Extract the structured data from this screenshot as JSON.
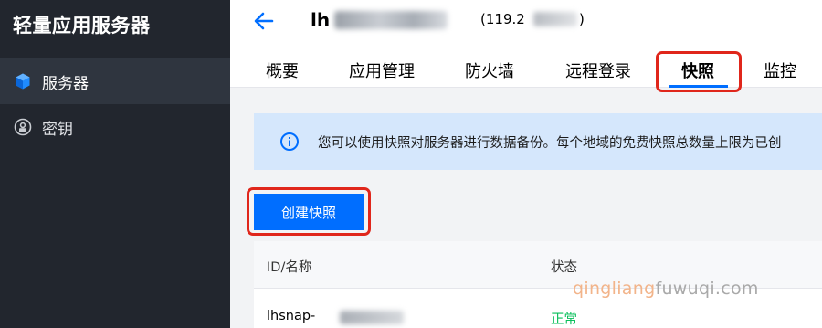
{
  "sidebar": {
    "brand": "轻量应用服务器",
    "items": [
      {
        "label": "服务器",
        "icon": "cube-icon",
        "active": true
      },
      {
        "label": "密钥",
        "icon": "key-circle-icon",
        "active": false
      }
    ]
  },
  "header": {
    "title": "lh",
    "ip_prefix": "(119.2",
    "ip_suffix": ")",
    "tabs": [
      {
        "label": "概要"
      },
      {
        "label": "应用管理"
      },
      {
        "label": "防火墙"
      },
      {
        "label": "远程登录"
      },
      {
        "label": "快照",
        "active": true
      },
      {
        "label": "监控"
      }
    ]
  },
  "banner": {
    "text": "您可以使用快照对服务器进行数据备份。每个地域的免费快照总数量上限为已创"
  },
  "actions": {
    "create_label": "创建快照"
  },
  "table": {
    "columns": [
      "ID/名称",
      "状态"
    ],
    "rows": [
      {
        "id": "lhsnap-",
        "status": "正常"
      }
    ]
  },
  "watermark": {
    "part1": "qingliang",
    "part2": "fuwuqi.com"
  },
  "colors": {
    "accent": "#006eff",
    "highlight": "#e0261b",
    "status_ok": "#0abf5b",
    "sidebar_bg": "#22262e"
  }
}
